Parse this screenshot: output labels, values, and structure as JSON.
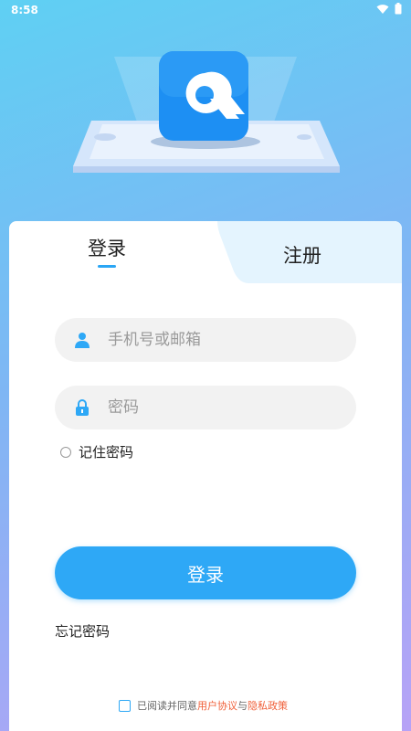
{
  "status_bar": {
    "time": "8:58",
    "wifi_icon": "wifi-icon",
    "battery_icon": "battery-icon"
  },
  "hero": {
    "logo_letter": "Q"
  },
  "tabs": {
    "login": "登录",
    "register": "注册"
  },
  "form": {
    "phone_placeholder": "手机号或邮箱",
    "password_placeholder": "密码",
    "remember_label": "记住密码",
    "submit_label": "登录",
    "forgot_label": "忘记密码"
  },
  "agreement": {
    "prefix": "已阅读并同意",
    "user_agreement": "用户协议",
    "connector": "与",
    "privacy_policy": "隐私政策"
  },
  "colors": {
    "accent": "#2ea8f6",
    "link": "#f0603a",
    "input_bg": "#f2f2f2"
  }
}
